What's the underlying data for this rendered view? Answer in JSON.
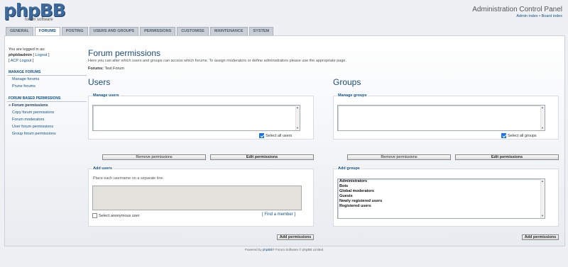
{
  "header": {
    "logo_text": "phpBB",
    "logo_sub": "forum software",
    "acp_title": "Administration Control Panel",
    "links": [
      "Admin index",
      "Board index"
    ],
    "link_sep": " • "
  },
  "tabs": [
    "GENERAL",
    "FORUMS",
    "POSTING",
    "USERS AND GROUPS",
    "PERMISSIONS",
    "CUSTOMISE",
    "MAINTENANCE",
    "SYSTEM"
  ],
  "sidebar": {
    "logged_in_text": "You are logged in as:",
    "username": "phpbbadmin",
    "logout": "Logout",
    "acp_logout": "ACP Logout",
    "section1": {
      "title": "MANAGE FORUMS",
      "items": [
        "Manage forums",
        "Prune forums"
      ]
    },
    "section2": {
      "title": "FORUM BASED PERMISSIONS",
      "items": [
        "Forum permissions",
        "Copy forum permissions",
        "Forum moderators",
        "User forum permissions",
        "Group forum permissions"
      ]
    }
  },
  "main": {
    "title": "Forum permissions",
    "description": "Here you can alter which users and groups can access which forums. To assign moderators or define administrators please use the appropriate page.",
    "forums_label": "Forums:",
    "forums_value": "Test Forum"
  },
  "users": {
    "heading": "Users",
    "manage_title": "Manage users",
    "select_all": "Select all users",
    "remove_btn": "Remove permissions",
    "edit_btn": "Edit permissions",
    "add_title": "Add users",
    "hint": "Place each username on a separate line.",
    "anon_label": "Select anonymous user",
    "find_member": "[ Find a member ]",
    "add_btn": "Add permissions"
  },
  "groups": {
    "heading": "Groups",
    "manage_title": "Manage groups",
    "select_all": "Select all groups",
    "remove_btn": "Remove permissions",
    "edit_btn": "Edit permissions",
    "add_title": "Add groups",
    "options": [
      "Administrators",
      "Bots",
      "Global moderators",
      "Guests",
      "Newly registered users",
      "Registered users"
    ],
    "add_btn": "Add permissions"
  },
  "footer": {
    "prefix": "Powered by ",
    "link": "phpBB",
    "suffix": "® Forum Software © phpBB Limited"
  },
  "colors": {
    "accent": "#105289",
    "heading": "#1d4c7a",
    "checkbox": "#1a73e8"
  }
}
